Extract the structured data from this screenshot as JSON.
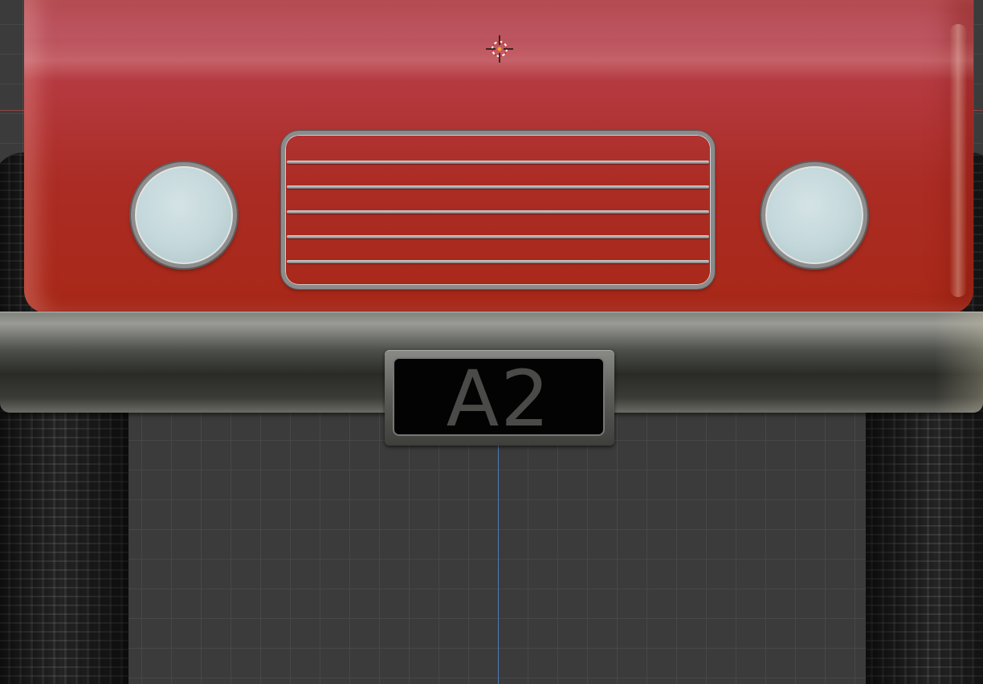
{
  "scene": {
    "vehicle": {
      "body_color": "#ab2c24",
      "trim_color": "#8b8b8b",
      "headlight_color": "#c3d7da",
      "license_plate": {
        "text": "A2",
        "background_color": "#030303",
        "text_color": "#4a4a48"
      }
    },
    "viewport": {
      "background_color": "#3b3b3b",
      "grid_color": "#474747",
      "axis_colors": {
        "vertical": "#4f7fc9",
        "horizontal": "#b34a4a"
      },
      "cursor_icon": "3d-cursor-icon"
    }
  }
}
